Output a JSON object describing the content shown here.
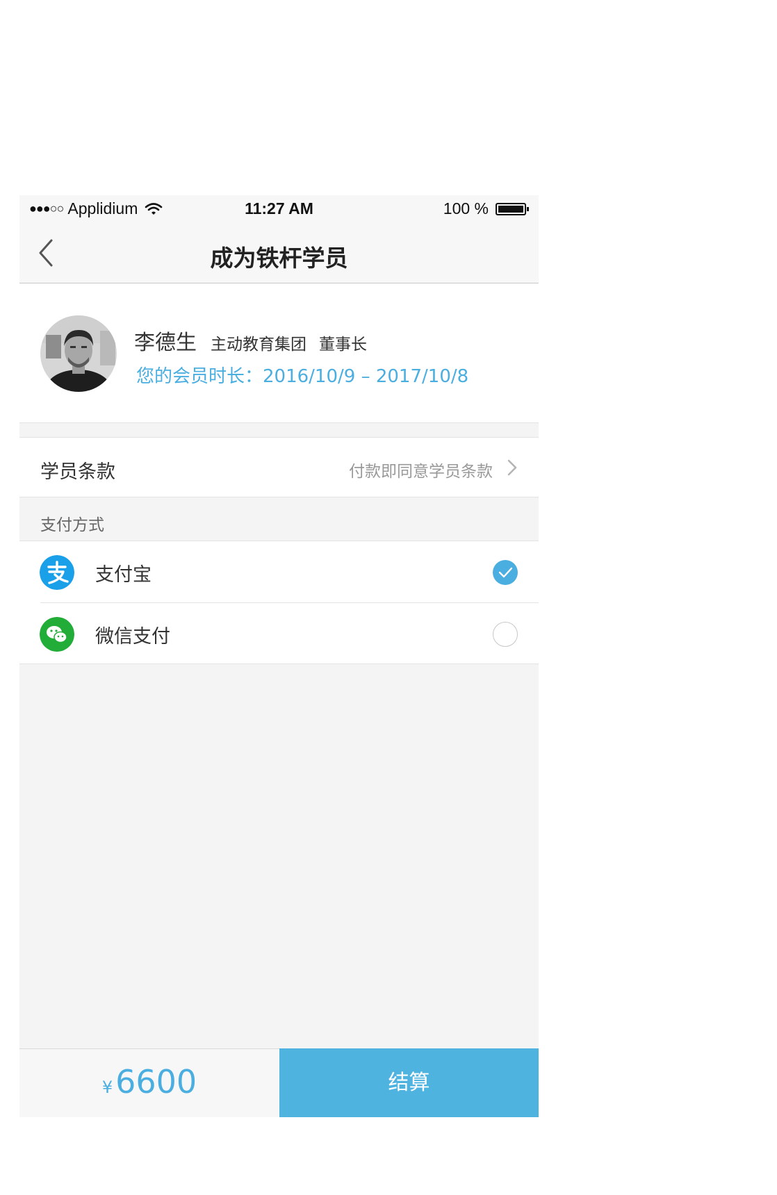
{
  "status_bar": {
    "signal": "●●●○○",
    "carrier": "Applidium",
    "time": "11:27 AM",
    "battery_text": "100 %"
  },
  "nav": {
    "title": "成为铁杆学员"
  },
  "profile": {
    "name": "李德生",
    "organization": "主动教育集团",
    "role": "董事长",
    "membership": "您的会员时长：2016/10/9 – 2017/10/8"
  },
  "terms": {
    "label": "学员条款",
    "link": "付款即同意学员条款"
  },
  "payment": {
    "header": "支付方式",
    "options": [
      {
        "label": "支付宝",
        "icon": "alipay-icon",
        "color": "#1aa0e8",
        "selected": true
      },
      {
        "label": "微信支付",
        "icon": "wechat-icon",
        "color": "#22ac38",
        "selected": false
      }
    ]
  },
  "footer": {
    "currency": "¥",
    "amount": "6600",
    "checkout_label": "结算"
  },
  "colors": {
    "accent": "#4aaee0",
    "checkout_bg": "#4fb3e0"
  }
}
